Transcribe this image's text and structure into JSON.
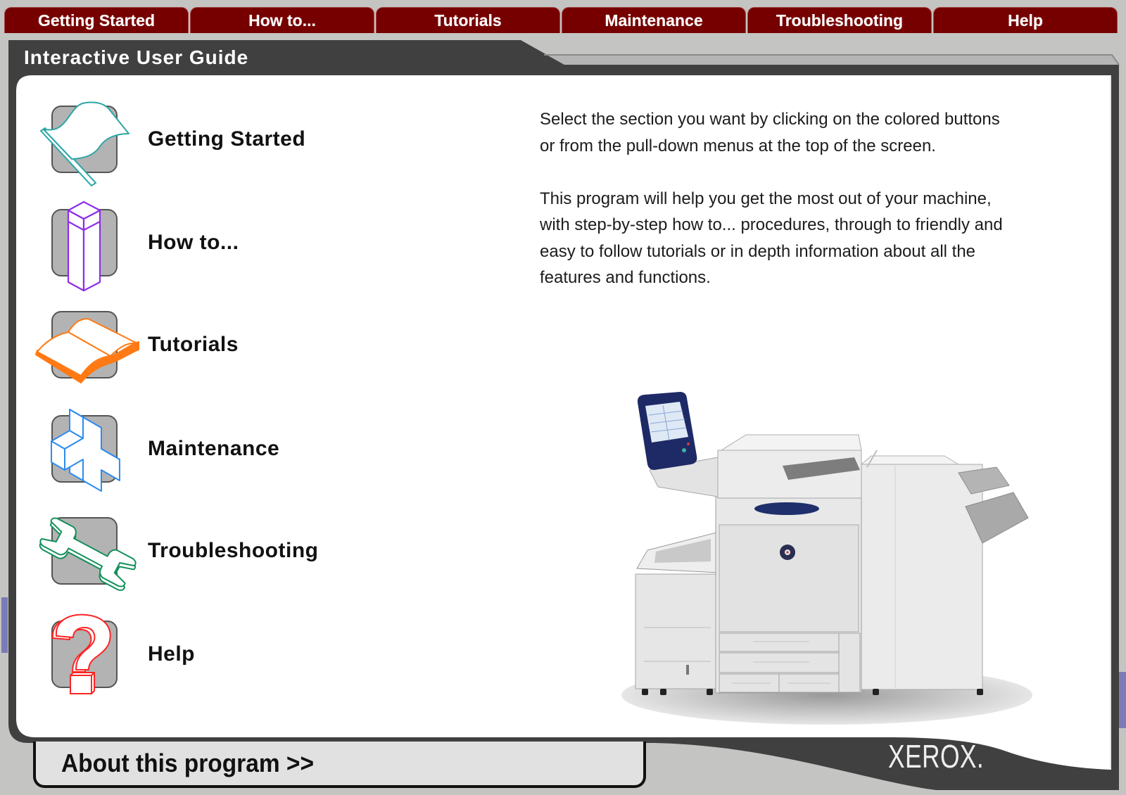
{
  "theme": {
    "tab_bg": "#760000",
    "frame_dark": "#404040",
    "side_strip": "#7b7bb8"
  },
  "menu_tabs": [
    {
      "label": "Getting Started"
    },
    {
      "label": "How to..."
    },
    {
      "label": "Tutorials"
    },
    {
      "label": "Maintenance"
    },
    {
      "label": "Troubleshooting"
    },
    {
      "label": "Help"
    }
  ],
  "header": {
    "title": "Interactive User Guide"
  },
  "sections": [
    {
      "label": "Getting Started",
      "icon": "flag-icon",
      "color": "#2ba6a6"
    },
    {
      "label": "How to...",
      "icon": "column-icon",
      "color": "#8e2de8"
    },
    {
      "label": "Tutorials",
      "icon": "open-book-icon",
      "color": "#ff7a14"
    },
    {
      "label": "Maintenance",
      "icon": "cross-icon",
      "color": "#2d8cf0"
    },
    {
      "label": "Troubleshooting",
      "icon": "wrench-icon",
      "color": "#13905a"
    },
    {
      "label": "Help",
      "icon": "question-mark-icon",
      "color": "#ff2424"
    }
  ],
  "intro": {
    "paragraphs": [
      [
        "Select the section you want by clicking on the colored buttons",
        "or from the pull-down menus at the top of the screen."
      ],
      [
        "This program will help you get the most out of your machine,",
        "with step-by-step how to... procedures, through to friendly and",
        "easy to follow tutorials or in depth information about all the",
        "features and functions."
      ]
    ]
  },
  "footer": {
    "about_label": "About this program >>",
    "brand": "XEROX."
  }
}
